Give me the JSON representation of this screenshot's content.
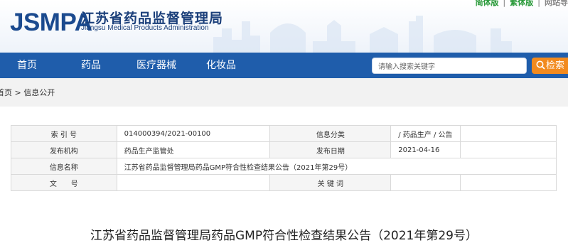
{
  "header": {
    "logo_text": "JSMPA",
    "org_name": "江苏省药品监督管理局",
    "org_name_en": "Jiangsu Medical Products Administration",
    "top_links": [
      "简体版",
      "繁体版",
      "网站导"
    ]
  },
  "nav": {
    "items": [
      {
        "label": "首页"
      },
      {
        "label": "药品"
      },
      {
        "label": "医疗器械"
      },
      {
        "label": "化妆品"
      }
    ],
    "search_placeholder": "请输入搜索关键字",
    "search_button": "检索"
  },
  "breadcrumb": {
    "home": "首页",
    "separator": ">",
    "current": "信息公开"
  },
  "info_table": {
    "rows": [
      {
        "label1": "索 引 号",
        "value1": "014000394/2021-00100",
        "label2": "信息分类",
        "value2": "/ 药品生产 / 公告",
        "value3": ""
      },
      {
        "label1": "发布机构",
        "value1": "药品生产监管处",
        "label2": "发布日期",
        "value2": "2021-04-16",
        "value3": ""
      },
      {
        "label1": "信息名称",
        "value1": "江苏省药品监督管理局药品GMP符合性检查结果公告（2021年第29号）"
      },
      {
        "label1": "文　　号",
        "value1": "",
        "label2": "关 键 词",
        "value2": "",
        "value3": ""
      }
    ]
  },
  "document": {
    "title": "江苏省药品监督管理局药品GMP符合性检查结果公告（2021年第29号）"
  },
  "colors": {
    "nav_bg": "#1f5dab",
    "search_button": "#f28a1e",
    "logo": "#1b4a8f",
    "top_link_active": "#2a9a3a"
  }
}
